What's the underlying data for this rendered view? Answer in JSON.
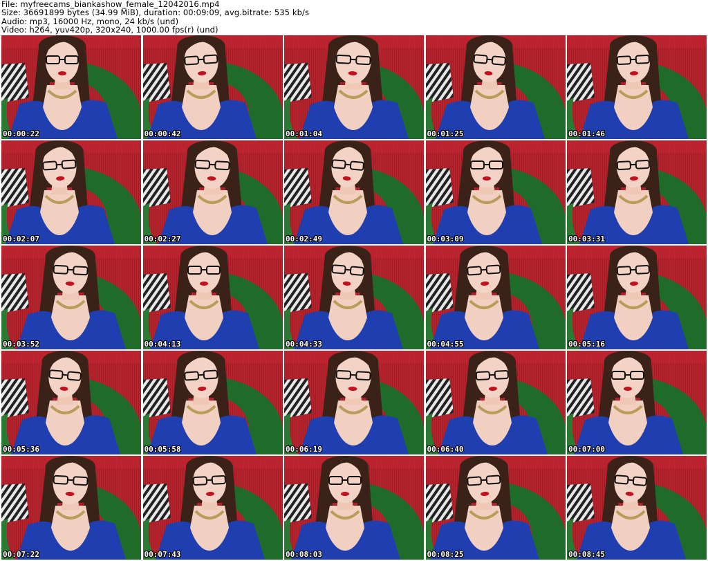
{
  "header": {
    "file_line": "File: myfreecams_biankashow_female_12042016.mp4",
    "size_line": "Size: 36691899 bytes (34.99 MiB), duration: 00:09:09, avg.bitrate: 535 kb/s",
    "audio_line": "Audio: mp3, 16000 Hz, mono, 24 kb/s (und)",
    "video_line": "Video: h264, yuv420p, 320x240, 1000.00 fps(r) (und)"
  },
  "thumbnails": [
    {
      "timestamp": "00:00:22",
      "variant": 0
    },
    {
      "timestamp": "00:00:42",
      "variant": 1
    },
    {
      "timestamp": "00:01:04",
      "variant": 2
    },
    {
      "timestamp": "00:01:25",
      "variant": 3
    },
    {
      "timestamp": "00:01:46",
      "variant": 4
    },
    {
      "timestamp": "00:02:07",
      "variant": 1
    },
    {
      "timestamp": "00:02:27",
      "variant": 2
    },
    {
      "timestamp": "00:02:49",
      "variant": 3
    },
    {
      "timestamp": "00:03:09",
      "variant": 0
    },
    {
      "timestamp": "00:03:31",
      "variant": 4
    },
    {
      "timestamp": "00:03:52",
      "variant": 2
    },
    {
      "timestamp": "00:04:13",
      "variant": 0
    },
    {
      "timestamp": "00:04:33",
      "variant": 3
    },
    {
      "timestamp": "00:04:55",
      "variant": 1
    },
    {
      "timestamp": "00:05:16",
      "variant": 4
    },
    {
      "timestamp": "00:05:36",
      "variant": 3
    },
    {
      "timestamp": "00:05:58",
      "variant": 1
    },
    {
      "timestamp": "00:06:19",
      "variant": 2
    },
    {
      "timestamp": "00:06:40",
      "variant": 4
    },
    {
      "timestamp": "00:07:00",
      "variant": 0
    },
    {
      "timestamp": "00:07:22",
      "variant": 2
    },
    {
      "timestamp": "00:07:43",
      "variant": 4
    },
    {
      "timestamp": "00:08:03",
      "variant": 0
    },
    {
      "timestamp": "00:08:25",
      "variant": 1
    },
    {
      "timestamp": "00:08:45",
      "variant": 3
    }
  ],
  "colors": {
    "background": "#ffffff",
    "backdrop_red": "#b5232d",
    "chair_green": "#1f6b2a",
    "dress_blue": "#1f3fb0",
    "hair_brown": "#3b2219",
    "skin": "#f1cfc1",
    "lips": "#c4101c",
    "timestamp_text": "#ffffff"
  }
}
